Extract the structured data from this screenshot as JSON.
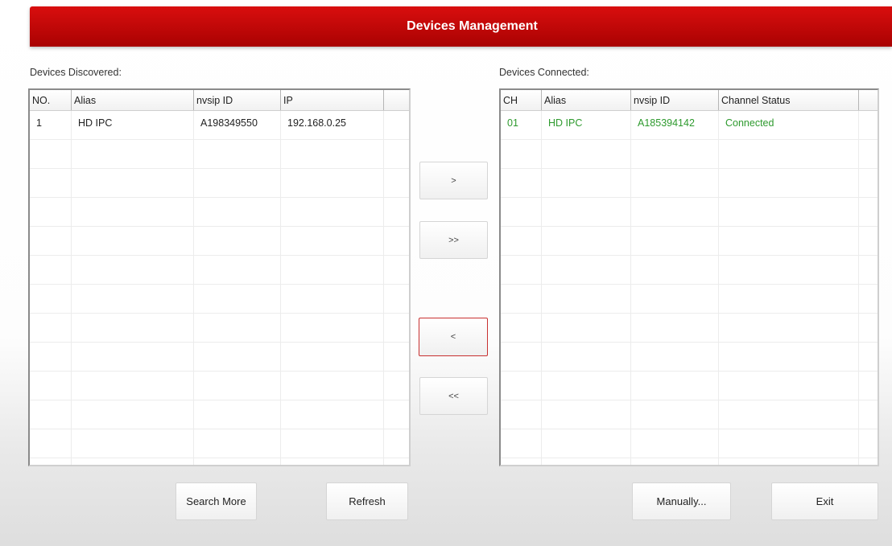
{
  "window": {
    "title": "Devices Management"
  },
  "discovered": {
    "label": "Devices Discovered:",
    "columns": [
      "NO.",
      "Alias",
      "nvsip ID",
      "IP",
      ""
    ],
    "rows": [
      {
        "no": "1",
        "alias": "HD IPC",
        "id": "A198349550",
        "ip": "192.168.0.25"
      }
    ]
  },
  "connected": {
    "label": "Devices Connected:",
    "columns": [
      "CH",
      "Alias",
      "nvsip ID",
      "Channel Status",
      ""
    ],
    "rows": [
      {
        "ch": "01",
        "alias": "HD IPC",
        "id": "A185394142",
        "status": "Connected"
      }
    ],
    "status_color": "#2e9a2e"
  },
  "transfer": {
    "add_one": ">",
    "add_all": ">>",
    "remove_one": "<",
    "remove_all": "<<"
  },
  "buttons": {
    "search_more": "Search More",
    "refresh": "Refresh",
    "manually": "Manually...",
    "exit": "Exit"
  },
  "colors": {
    "title_bar": "#c80808",
    "active_border": "#c83030"
  }
}
